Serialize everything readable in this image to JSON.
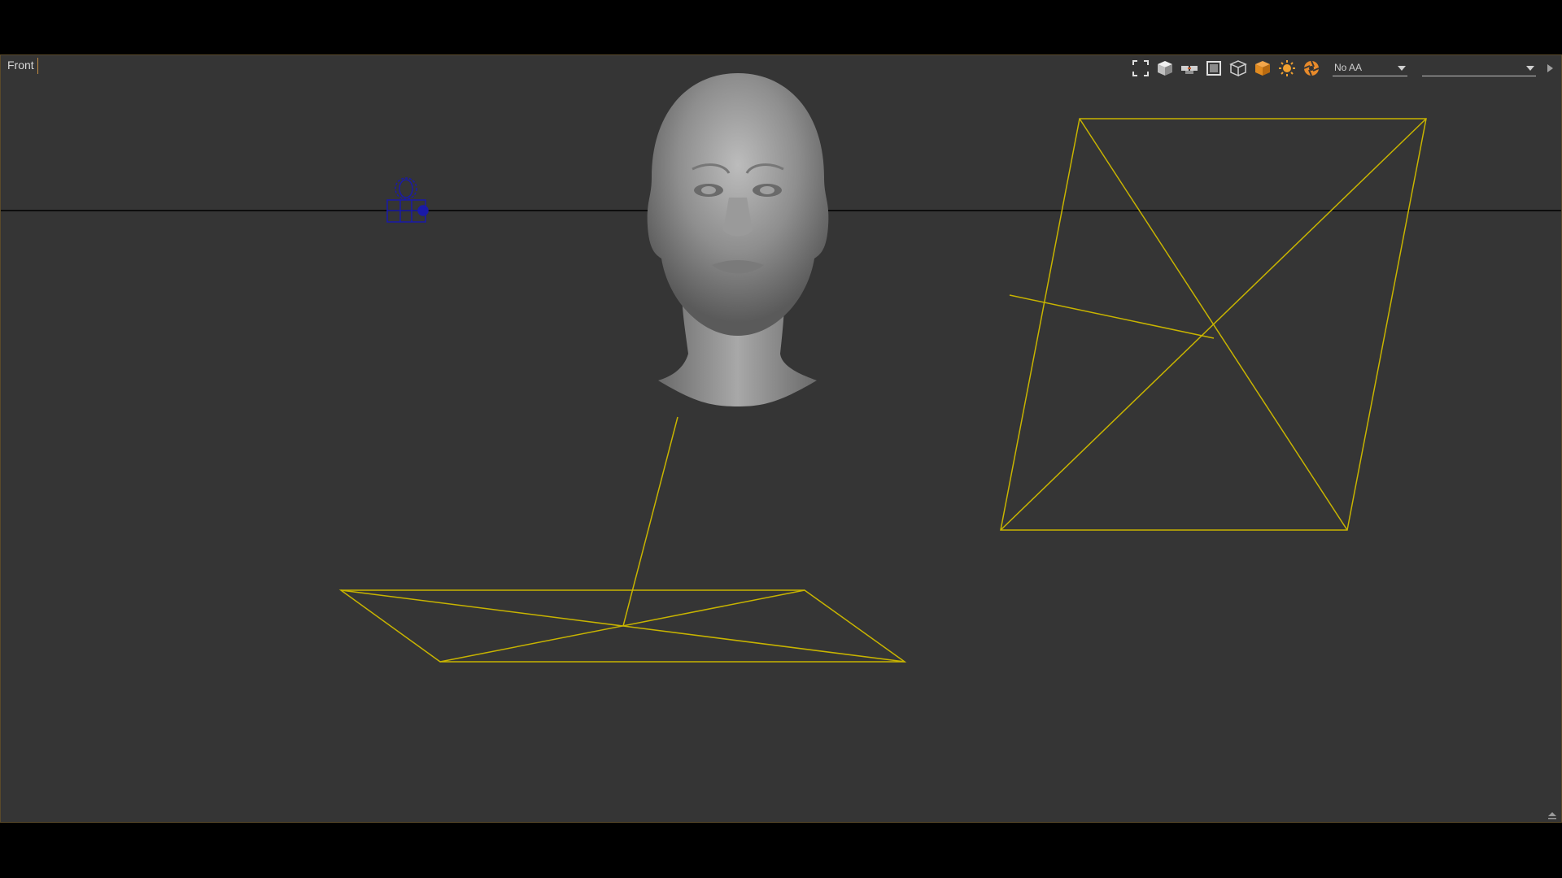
{
  "viewport": {
    "view_name": "Front",
    "background_color": "#353535",
    "wireframe_color": "#c8b400",
    "node_color": "#1a1aa8"
  },
  "toolbar": {
    "icons": [
      "fullscreen-icon",
      "shaded-cube-icon",
      "view-pair-icon",
      "frame-icon",
      "wire-cube-icon",
      "render-cube-icon",
      "sun-light-icon",
      "aperture-icon"
    ],
    "antialias_selected": "No AA",
    "camera_selected": ""
  }
}
